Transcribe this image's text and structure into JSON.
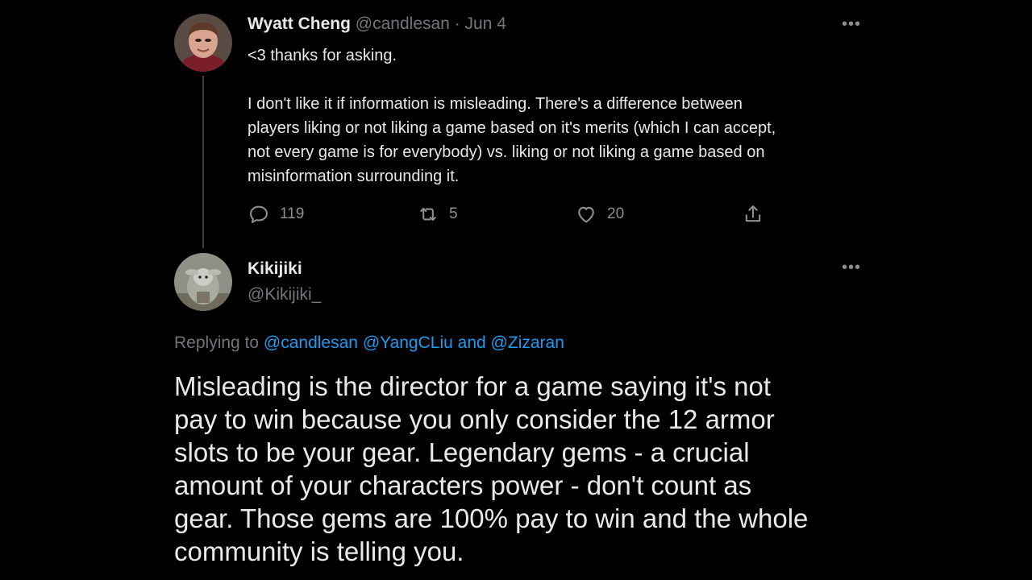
{
  "tweet1": {
    "author_name": "Wyatt Cheng",
    "handle": "@candlesan",
    "separator": "·",
    "date": "Jun 4",
    "more_label": "•••",
    "paragraph1": "<3 thanks for asking.",
    "paragraph2_lines": [
      "I don't like it if information is misleading. There's a difference between",
      "players liking or not liking a game based on it's merits (which I can accept,",
      "not every game is for everybody) vs. liking or not liking a game based on",
      "misinformation surrounding it."
    ],
    "reply_count": "119",
    "retweet_count": "5",
    "like_count": "20",
    "icons": {
      "reply": "reply-icon",
      "retweet": "retweet-icon",
      "like": "heart-icon",
      "share": "share-icon"
    }
  },
  "tweet2": {
    "author_name": "Kikijiki",
    "handle": "@Kikijiki_",
    "more_label": "•••",
    "replying_prefix": "Replying to",
    "mention1": "@candlesan",
    "mention2": "@YangCLiu",
    "mention_and": "and",
    "mention3": "@Zizaran",
    "body_lines": [
      "Misleading is the director for a game saying it's not",
      "pay to win because you only consider the 12 armor",
      "slots to be your gear. Legendary gems - a crucial",
      "amount of your characters power - don't count as",
      "gear. Those gems are 100% pay to win and the whole",
      "community is telling you."
    ]
  },
  "colors": {
    "background": "#000000",
    "text": "#e7e9ea",
    "muted": "#71767b",
    "link": "#1d9bf0",
    "thread_line": "#3a3d40"
  }
}
